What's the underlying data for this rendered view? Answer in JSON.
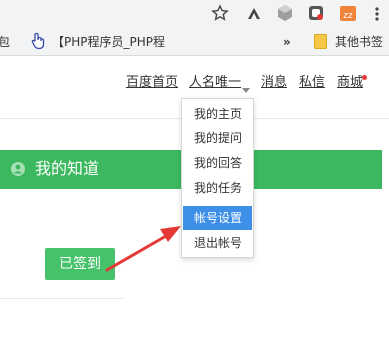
{
  "browser": {
    "bookmarks": [
      {
        "label": "包"
      },
      {
        "label": "【PHP程序员_PHP程"
      },
      {
        "label": "»"
      },
      {
        "label": "其他书签"
      }
    ]
  },
  "nav": {
    "home": "百度首页",
    "username": "人名唯一",
    "messages": "消息",
    "private_msg": "私信",
    "mall": "商城"
  },
  "dropdown": {
    "items": [
      {
        "label": "我的主页"
      },
      {
        "label": "我的提问"
      },
      {
        "label": "我的回答"
      },
      {
        "label": "我的任务"
      },
      {
        "label": "帐号设置",
        "active": true
      },
      {
        "label": "退出帐号"
      }
    ]
  },
  "banner": {
    "title": "我的知道"
  },
  "signin": {
    "label": "已签到"
  },
  "colors": {
    "accent_green": "#3cb95f",
    "highlight_blue": "#3d8fe8",
    "annotation_red": "#e53935"
  }
}
